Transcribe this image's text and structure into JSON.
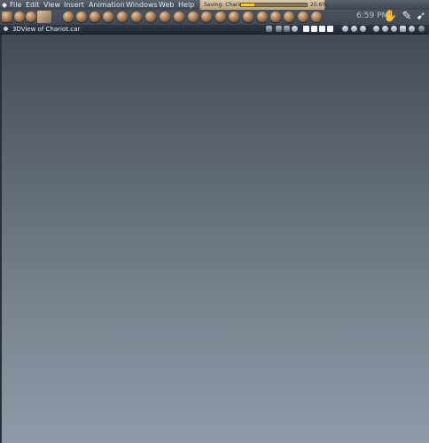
{
  "menubar": {
    "apple": "◆",
    "items": [
      {
        "label": "File"
      },
      {
        "label": "Edit"
      },
      {
        "label": "View"
      },
      {
        "label": "Insert"
      },
      {
        "label": "Animation"
      },
      {
        "label": "Windows"
      },
      {
        "label": "Web"
      },
      {
        "label": "Help"
      }
    ]
  },
  "progress": {
    "label": "Saving: Chariot",
    "percent_text": "20.6%",
    "fraction": 0.206
  },
  "clock": "6:59 PM",
  "window": {
    "title": "3DView of Chariot.car"
  },
  "toolbar": {
    "icons": [
      "select-tool-icon",
      "hand-tool-icon",
      "eyedropper-tool-icon",
      "camera-tool-icon",
      "sphere-icon",
      "cylinder-icon",
      "torus-icon",
      "cone-icon",
      "spring-icon",
      "gear-icon",
      "cube-icon",
      "plane-icon",
      "lathe-icon",
      "hand-icon",
      "deform-icon",
      "star-icon",
      "figure-icon",
      "points-icon",
      "target-icon",
      "wand-icon"
    ]
  },
  "colors": {
    "progress_fill": "#f1d13a",
    "menubar_bg": "#4b535f",
    "viewport_top": "#434b56",
    "viewport_bottom": "#8f9aa8"
  }
}
